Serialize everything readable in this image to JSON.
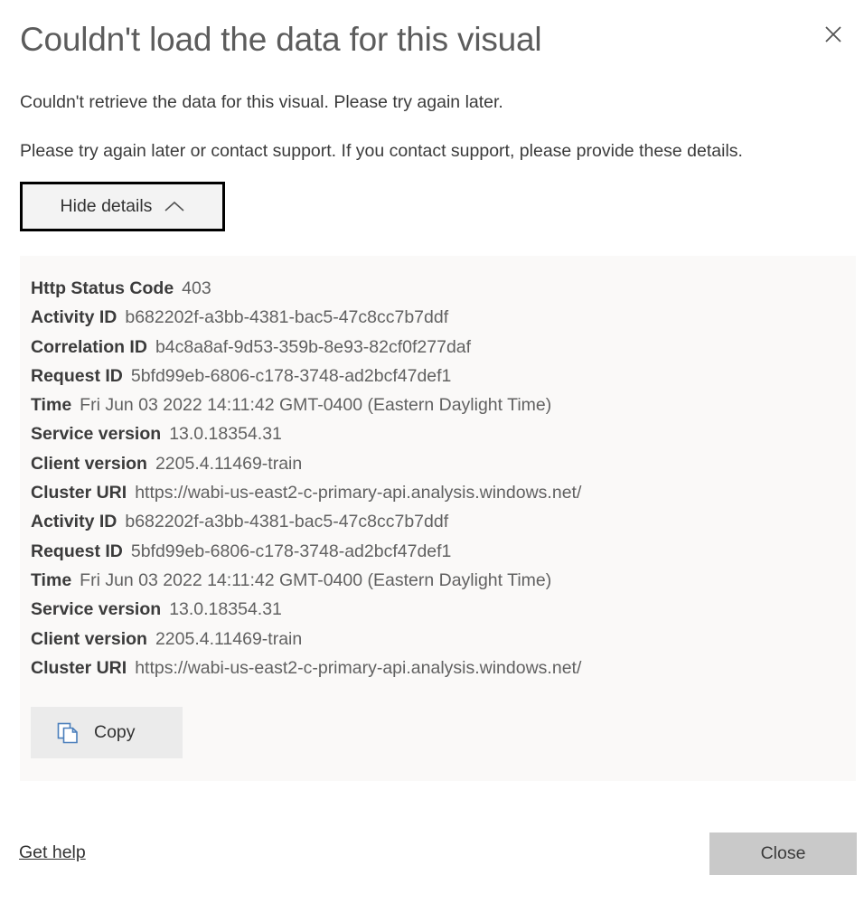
{
  "dialog": {
    "title": "Couldn't load the data for this visual",
    "close_icon_label": "Close",
    "paragraph_1": "Couldn't retrieve the data for this visual. Please try again later.",
    "paragraph_2": "Please try again later or contact support. If you contact support, please provide these details."
  },
  "toggle": {
    "hide_details_label": "Hide details"
  },
  "details": {
    "rows": [
      {
        "label": "Http Status Code",
        "value": "403"
      },
      {
        "label": "Activity ID",
        "value": "b682202f-a3bb-4381-bac5-47c8cc7b7ddf"
      },
      {
        "label": "Correlation ID",
        "value": "b4c8a8af-9d53-359b-8e93-82cf0f277daf"
      },
      {
        "label": "Request ID",
        "value": "5bfd99eb-6806-c178-3748-ad2bcf47def1"
      },
      {
        "label": "Time",
        "value": "Fri Jun 03 2022 14:11:42 GMT-0400 (Eastern Daylight Time)"
      },
      {
        "label": "Service version",
        "value": "13.0.18354.31"
      },
      {
        "label": "Client version",
        "value": "2205.4.11469-train"
      },
      {
        "label": "Cluster URI",
        "value": "https://wabi-us-east2-c-primary-api.analysis.windows.net/"
      },
      {
        "label": "Activity ID",
        "value": "b682202f-a3bb-4381-bac5-47c8cc7b7ddf"
      },
      {
        "label": "Request ID",
        "value": "5bfd99eb-6806-c178-3748-ad2bcf47def1"
      },
      {
        "label": "Time",
        "value": "Fri Jun 03 2022 14:11:42 GMT-0400 (Eastern Daylight Time)"
      },
      {
        "label": "Service version",
        "value": "13.0.18354.31"
      },
      {
        "label": "Client version",
        "value": "2205.4.11469-train"
      },
      {
        "label": "Cluster URI",
        "value": "https://wabi-us-east2-c-primary-api.analysis.windows.net/"
      }
    ]
  },
  "copy": {
    "label": "Copy"
  },
  "footer": {
    "get_help_label": "Get help",
    "close_label": "Close"
  },
  "colors": {
    "panel_background": "#faf9f8",
    "copy_icon_blue": "#4a7ebb",
    "close_button_background": "#c9c9c9",
    "title_text": "#5c5c5c",
    "focus_border": "#000000"
  }
}
